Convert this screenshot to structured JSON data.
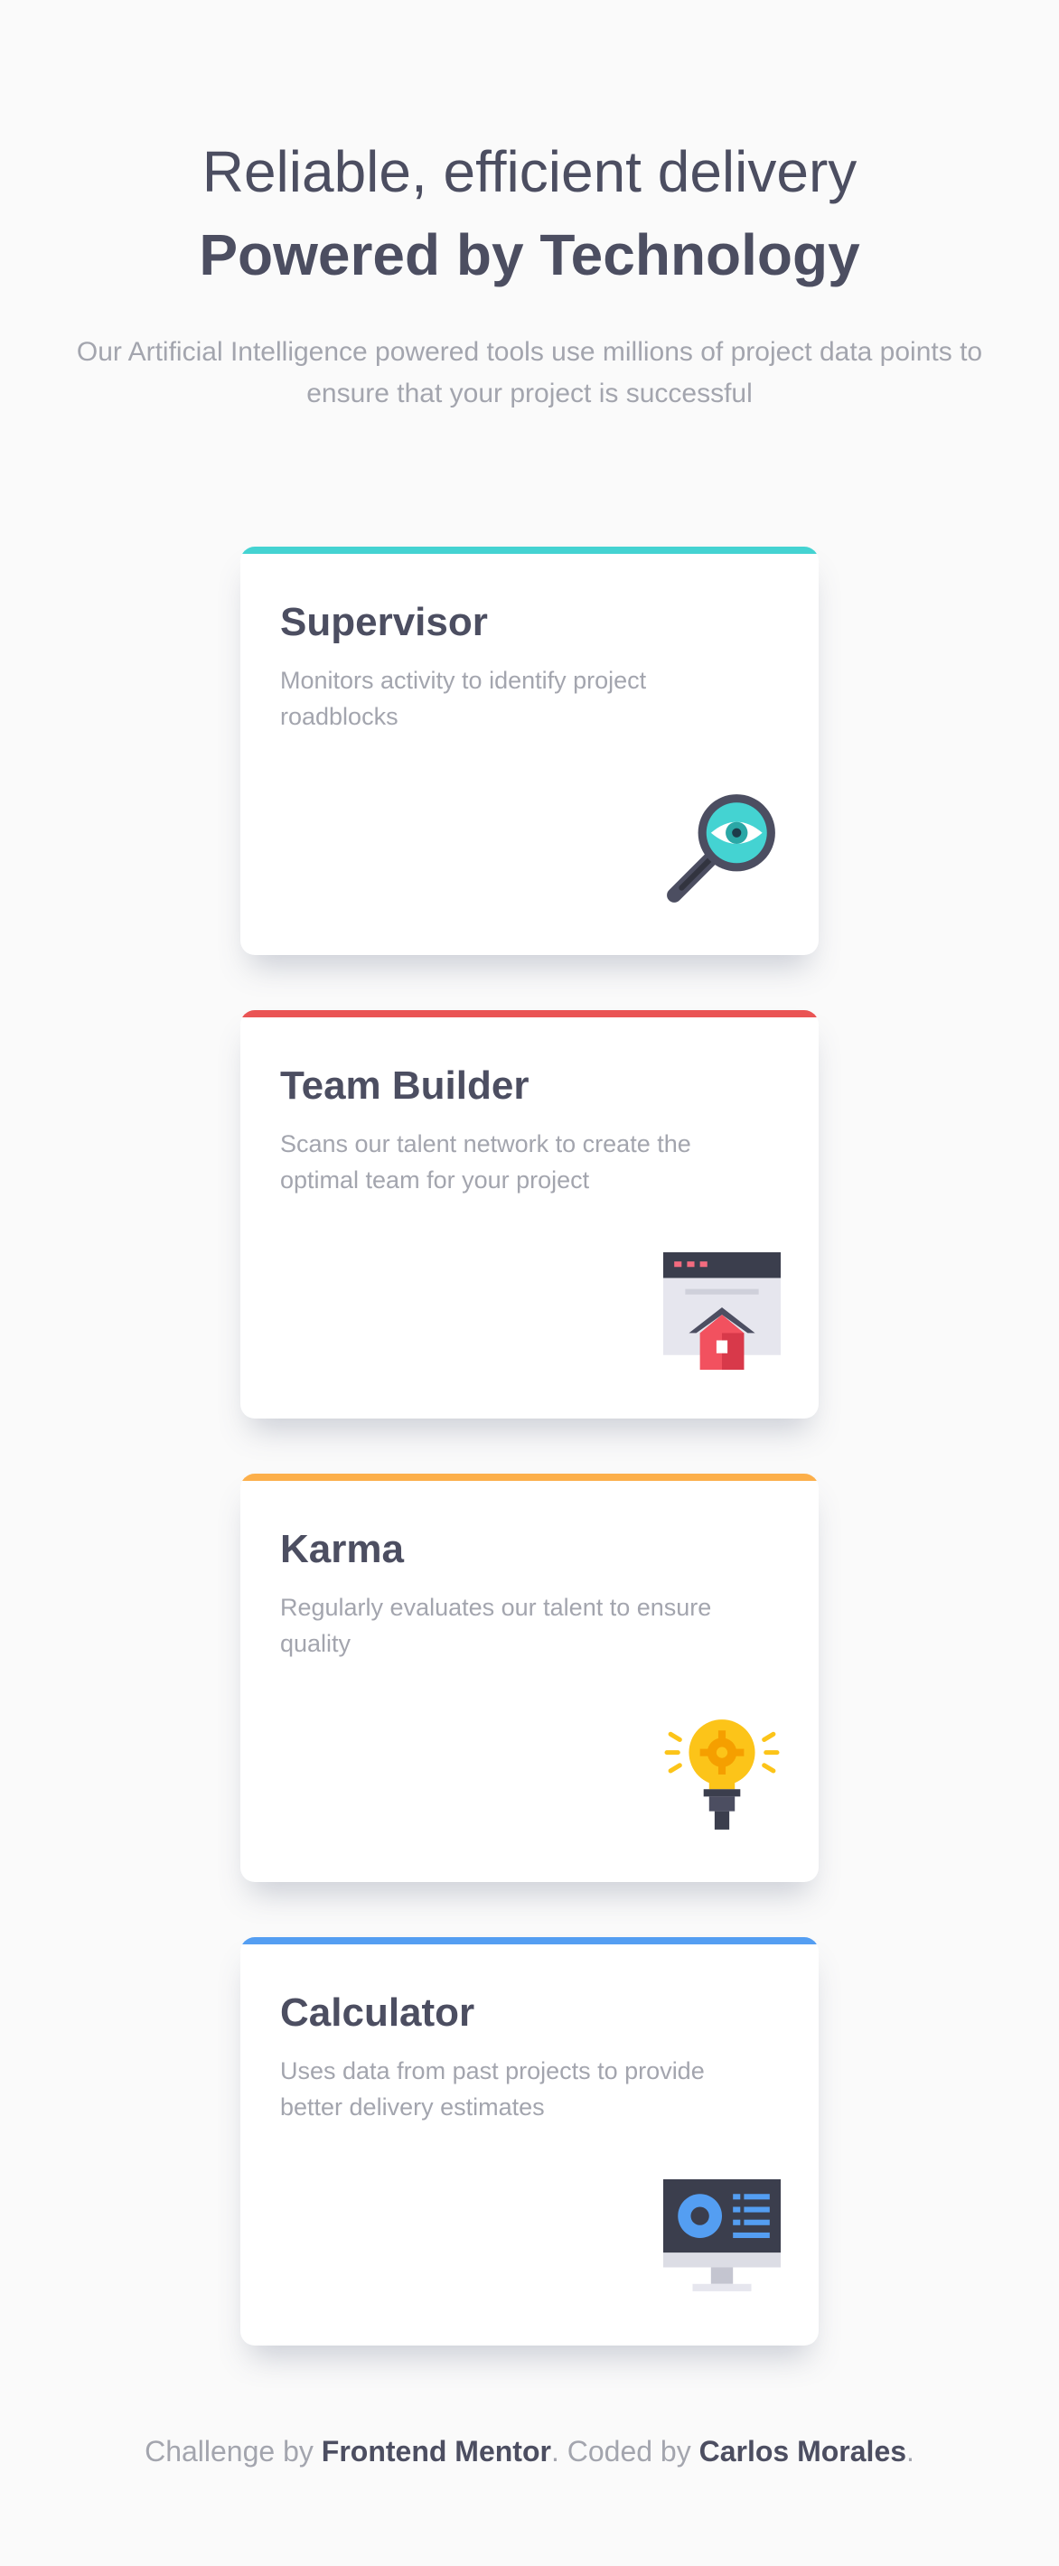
{
  "header": {
    "line1": "Reliable, efficient delivery",
    "line2": "Powered by Technology",
    "description": "Our Artificial Intelligence powered tools use millions of project data points to ensure that your project is successful"
  },
  "cards": [
    {
      "title": "Supervisor",
      "text": "Monitors activity to identify project roadblocks",
      "accent": "#44d3d2",
      "icon": "magnifier-eye-icon"
    },
    {
      "title": "Team Builder",
      "text": "Scans our talent network to create the optimal team for your project",
      "accent": "#ea5454",
      "icon": "browser-house-icon"
    },
    {
      "title": "Karma",
      "text": "Regularly evaluates our talent to ensure quality",
      "accent": "#fcaf4a",
      "icon": "lightbulb-gear-icon"
    },
    {
      "title": "Calculator",
      "text": "Uses data from past projects to provide better delivery estimates",
      "accent": "#549ef2",
      "icon": "monitor-chart-icon"
    }
  ],
  "footer": {
    "prefix": "Challenge by",
    "link1": "Frontend Mentor",
    "middle": ". Coded by",
    "link2": "Carlos Morales",
    "suffix": "."
  }
}
